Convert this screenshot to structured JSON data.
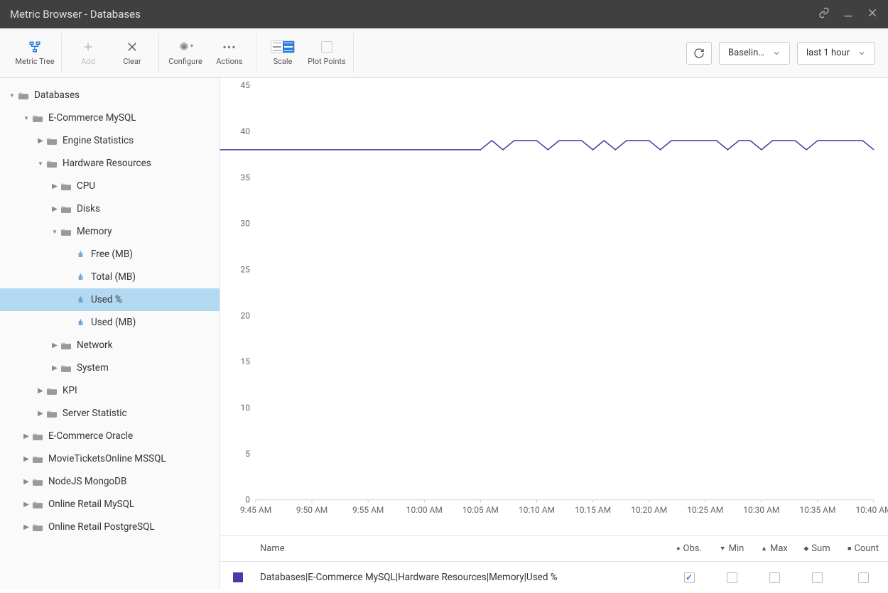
{
  "window": {
    "title": "Metric Browser - Databases"
  },
  "toolbar": {
    "metric_tree": "Metric Tree",
    "add": "Add",
    "clear": "Clear",
    "configure": "Configure",
    "actions": "Actions",
    "scale": "Scale",
    "plot_points": "Plot Points",
    "baseline": "Baseline…",
    "time_range": "last 1 hour"
  },
  "tree": {
    "n0": "Databases",
    "n1": "E-Commerce MySQL",
    "n2": "Engine Statistics",
    "n3": "Hardware Resources",
    "n4": "CPU",
    "n5": "Disks",
    "n6": "Memory",
    "n7": "Free (MB)",
    "n8": "Total (MB)",
    "n9": "Used %",
    "n10": "Used (MB)",
    "n11": "Network",
    "n12": "System",
    "n13": "KPI",
    "n14": "Server Statistic",
    "n15": "E-Commerce Oracle",
    "n16": "MovieTicketsOnline MSSQL",
    "n17": "NodeJS MongoDB",
    "n18": "Online Retail MySQL",
    "n19": "Online Retail PostgreSQL"
  },
  "table": {
    "header_name": "Name",
    "header_obs": "Obs.",
    "header_min": "Min",
    "header_max": "Max",
    "header_sum": "Sum",
    "header_count": "Count",
    "row0_name": "Databases|E-Commerce MySQL|Hardware Resources|Memory|Used %"
  },
  "chart_data": {
    "type": "line",
    "title": "",
    "xlabel": "",
    "ylabel": "",
    "ylim": [
      0,
      45
    ],
    "yticks": [
      0,
      5,
      10,
      15,
      20,
      25,
      30,
      35,
      40,
      45
    ],
    "xticks": [
      "9:45 AM",
      "9:50 AM",
      "9:55 AM",
      "10:00 AM",
      "10:05 AM",
      "10:10 AM",
      "10:15 AM",
      "10:20 AM",
      "10:25 AM",
      "10:30 AM",
      "10:35 AM",
      "10:40 AM"
    ],
    "series": [
      {
        "name": "Used %",
        "color": "#4a3aa8",
        "x": [
          "9:41",
          "9:42",
          "9:43",
          "9:44",
          "9:45",
          "9:46",
          "9:47",
          "9:48",
          "9:49",
          "9:50",
          "9:51",
          "9:52",
          "9:53",
          "9:54",
          "9:55",
          "9:56",
          "9:57",
          "9:58",
          "9:59",
          "10:00",
          "10:01",
          "10:02",
          "10:03",
          "10:04",
          "10:05",
          "10:06",
          "10:07",
          "10:08",
          "10:09",
          "10:10",
          "10:11",
          "10:12",
          "10:13",
          "10:14",
          "10:15",
          "10:16",
          "10:17",
          "10:18",
          "10:19",
          "10:20",
          "10:21",
          "10:22",
          "10:23",
          "10:24",
          "10:25",
          "10:26",
          "10:27",
          "10:28",
          "10:29",
          "10:30",
          "10:31",
          "10:32",
          "10:33",
          "10:34",
          "10:35",
          "10:36",
          "10:37",
          "10:38",
          "10:39",
          "10:40"
        ],
        "values": [
          38,
          38,
          38,
          38,
          38,
          38,
          38,
          38,
          38,
          38,
          38,
          38,
          38,
          38,
          38,
          38,
          38,
          38,
          38,
          38,
          38,
          38,
          38,
          38,
          38,
          39,
          38,
          39,
          39,
          39,
          38,
          39,
          39,
          39,
          38,
          39,
          38,
          39,
          39,
          39,
          38,
          39,
          39,
          39,
          39,
          39,
          38,
          39,
          39,
          38,
          39,
          39,
          39,
          38,
          39,
          39,
          39,
          39,
          39,
          38
        ]
      }
    ]
  }
}
